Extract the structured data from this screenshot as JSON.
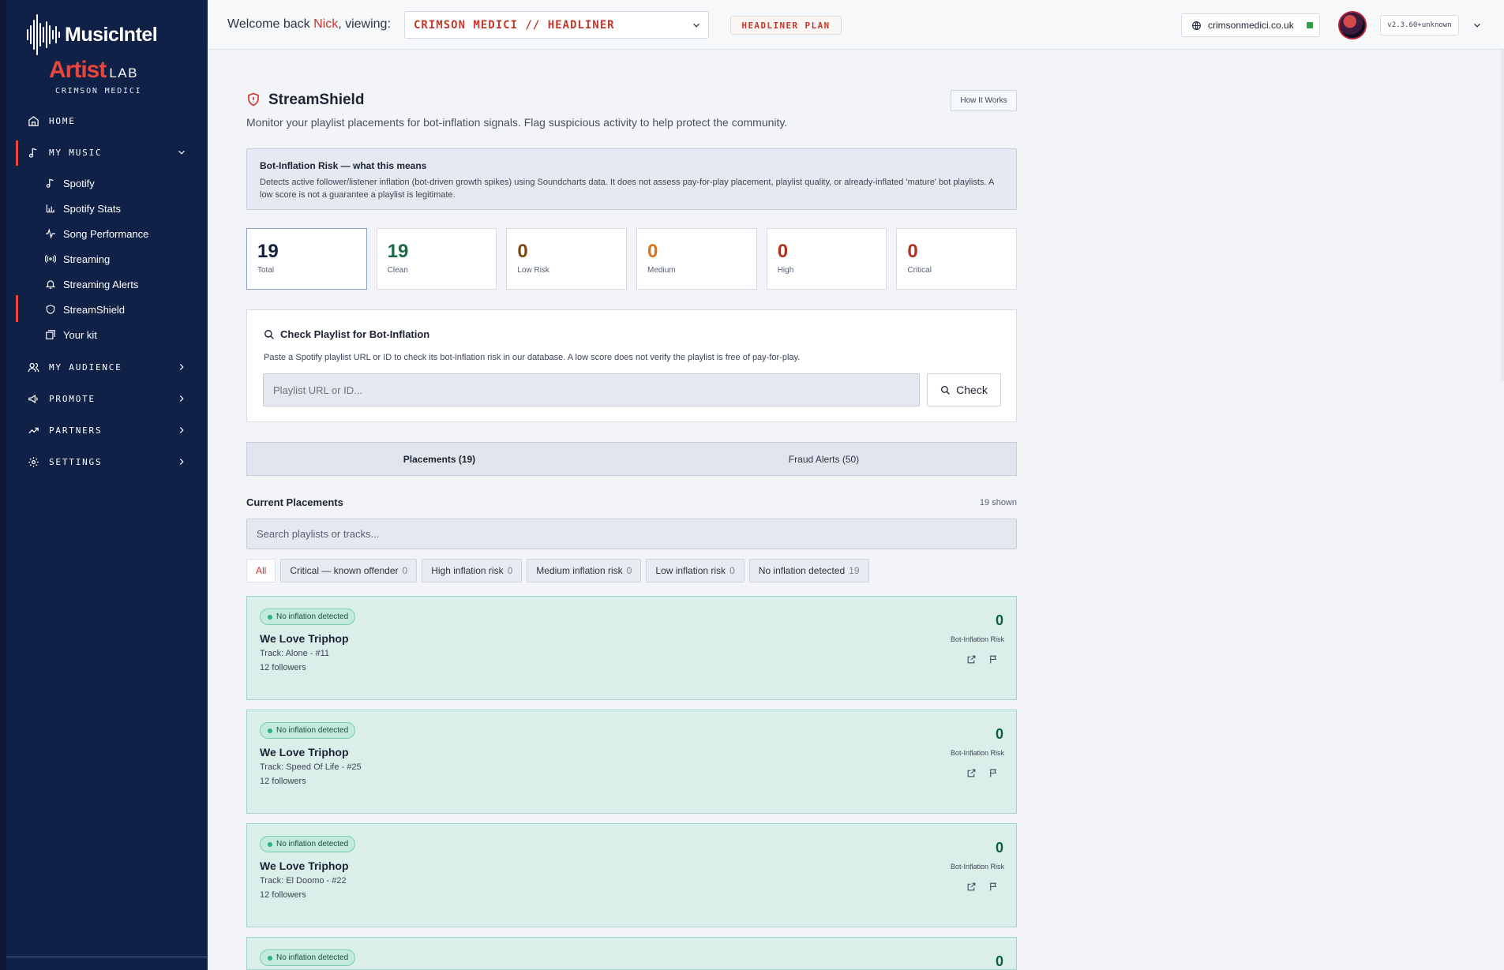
{
  "brand": {
    "name": "MusicIntel",
    "artist_word": "Artist",
    "lab_word": "LAB",
    "artist_name": "CRIMSON MEDICI"
  },
  "sidebar": {
    "home": "HOME",
    "my_music": "MY MUSIC",
    "music_items": [
      {
        "label": "Spotify",
        "icon": "music-note-icon"
      },
      {
        "label": "Spotify Stats",
        "icon": "bar-chart-icon"
      },
      {
        "label": "Song Performance",
        "icon": "activity-icon"
      },
      {
        "label": "Streaming",
        "icon": "radio-icon"
      },
      {
        "label": "Streaming Alerts",
        "icon": "bell-icon"
      },
      {
        "label": "StreamShield",
        "icon": "shield-icon"
      },
      {
        "label": "Your kit",
        "icon": "kit-icon"
      }
    ],
    "my_audience": "MY AUDIENCE",
    "promote": "PROMOTE",
    "partners": "PARTNERS",
    "settings": "SETTINGS"
  },
  "header": {
    "welcome_prefix": "Welcome back",
    "user": "Nick",
    "welcome_suffix": ", viewing:",
    "artist_selected": "CRIMSON MEDICI // HEADLINER",
    "plan": "HEADLINER PLAN",
    "domain": "crimsonmedici.co.uk",
    "version": "v2.3.60+unknown"
  },
  "page": {
    "title": "StreamShield",
    "how_it_works": "How It Works",
    "subtitle": "Monitor your playlist placements for bot-inflation signals. Flag suspicious activity to help protect the community."
  },
  "info": {
    "title": "Bot-Inflation Risk — what this means",
    "text": "Detects active follower/listener inflation (bot-driven growth spikes) using Soundcharts data. It does not assess pay-for-play placement, playlist quality, or already-inflated 'mature' bot playlists. A low score is not a guarantee a playlist is legitimate."
  },
  "stats": [
    {
      "value": "19",
      "label": "Total",
      "color": "#15213d"
    },
    {
      "value": "19",
      "label": "Clean",
      "color": "#1d6b46"
    },
    {
      "value": "0",
      "label": "Low Risk",
      "color": "#7a4a12"
    },
    {
      "value": "0",
      "label": "Medium",
      "color": "#d5731f"
    },
    {
      "value": "0",
      "label": "High",
      "color": "#b03123"
    },
    {
      "value": "0",
      "label": "Critical",
      "color": "#b03123"
    }
  ],
  "check": {
    "title": "Check Playlist for Bot-Inflation",
    "help": "Paste a Spotify playlist URL or ID to check its bot-inflation risk in our database. A low score does not verify the playlist is free of pay-for-play.",
    "placeholder": "Playlist URL or ID...",
    "button": "Check"
  },
  "tabs": [
    {
      "label": "Placements (19)"
    },
    {
      "label": "Fraud Alerts (50)"
    }
  ],
  "list": {
    "title": "Current Placements",
    "count": "19 shown",
    "search_placeholder": "Search playlists or tracks...",
    "filters": [
      {
        "label": "All",
        "count": ""
      },
      {
        "label": "Critical — known offender",
        "count": "0"
      },
      {
        "label": "High inflation risk",
        "count": "0"
      },
      {
        "label": "Medium inflation risk",
        "count": "0"
      },
      {
        "label": "Low inflation risk",
        "count": "0"
      },
      {
        "label": "No inflation detected",
        "count": "19"
      }
    ]
  },
  "placements": [
    {
      "badge": "No inflation detected",
      "name": "We Love Triphop",
      "track": "Track: Alone   - #11",
      "followers": "12 followers",
      "score": "0",
      "score_label": "Bot-Inflation Risk"
    },
    {
      "badge": "No inflation detected",
      "name": "We Love Triphop",
      "track": "Track: Speed Of Life   - #25",
      "followers": "12 followers",
      "score": "0",
      "score_label": "Bot-Inflation Risk"
    },
    {
      "badge": "No inflation detected",
      "name": "We Love Triphop",
      "track": "Track: El Doomo   - #22",
      "followers": "12 followers",
      "score": "0",
      "score_label": "Bot-Inflation Risk"
    },
    {
      "badge": "No inflation detected",
      "name": "",
      "track": "",
      "followers": "",
      "score": "0",
      "score_label": ""
    }
  ]
}
